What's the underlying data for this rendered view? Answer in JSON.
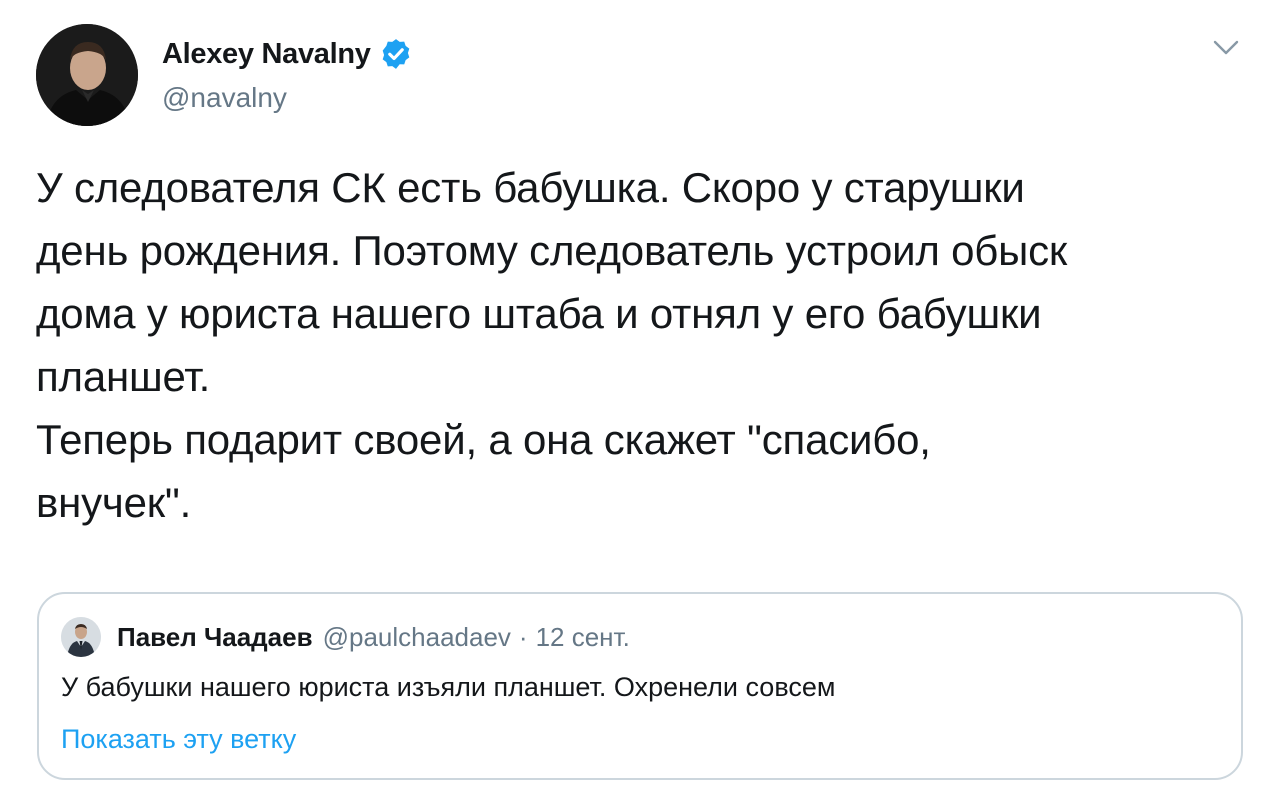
{
  "author": {
    "name": "Alexey Navalny",
    "handle": "@navalny",
    "verified": true
  },
  "tweet": {
    "lines": [
      "У следователя СК есть бабушка. Скоро у старушки",
      "день рождения. Поэтому следователь устроил обыск",
      "дома у юриста нашего штаба и отнял у его бабушки",
      "планшет.",
      "Теперь подарит своей, а она скажет \"спасибо,",
      "внучек\"."
    ]
  },
  "quote": {
    "name": "Павел Чаадаев",
    "handle": "@paulchaadaev",
    "separator": "·",
    "date": "12 сент.",
    "text": "У бабушки нашего юриста изъяли планшет. Охренели совсем",
    "show_thread": "Показать эту ветку"
  },
  "icons": {
    "verified": "verified-badge-icon",
    "caret": "chevron-down-icon"
  },
  "colors": {
    "accent": "#1da1f2",
    "secondary_text": "#657786",
    "border": "#ccd6dd"
  }
}
